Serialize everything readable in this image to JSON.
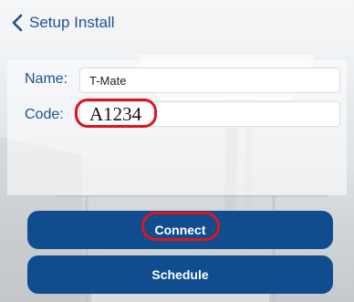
{
  "nav": {
    "back_label": "Setup Install"
  },
  "form": {
    "name_label": "Name:",
    "name_value": "T-Mate",
    "code_label": "Code:",
    "code_value": "A1234"
  },
  "actions": {
    "connect_label": "Connect",
    "schedule_label": "Schedule"
  },
  "colors": {
    "accent": "#1e5196",
    "button_bg": "#0f4d8f",
    "highlight": "#e0141b"
  }
}
